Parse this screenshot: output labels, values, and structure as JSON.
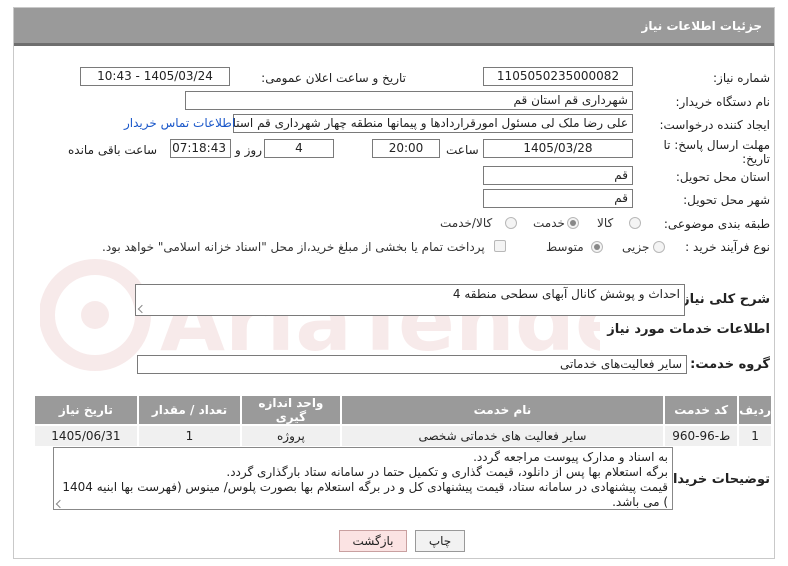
{
  "header": {
    "title": "جزئیات اطلاعات نیاز"
  },
  "form": {
    "need_number": {
      "label": "شماره نیاز:",
      "value": "1105050235000082"
    },
    "announce_datetime": {
      "label": "تاریخ و ساعت اعلان عمومی:",
      "value": "1405/03/24 - 10:43"
    },
    "buyer_org": {
      "label": "نام دستگاه خریدار:",
      "value": "شهرداری قم استان قم"
    },
    "requester": {
      "label": "ایجاد کننده درخواست:",
      "value": "علی رضا ملک لی مسئول امورقراردادها و پیمانها منطقه چهار  شهرداری قم استان قم",
      "contact_link": "اطلاعات تماس خریدار"
    },
    "deadline": {
      "label": "مهلت ارسال پاسخ: تا تاریخ:",
      "date": "1405/03/28",
      "time_label": "ساعت",
      "time": "20:00",
      "days": "4",
      "days_label": "روز و",
      "remaining": "07:18:43",
      "remaining_label": "ساعت باقی مانده"
    },
    "province": {
      "label": "استان محل تحویل:",
      "value": "قم"
    },
    "city": {
      "label": "شهر محل تحویل:",
      "value": "قم"
    },
    "category": {
      "label": "طبقه بندی موضوعی:",
      "options": [
        "کالا",
        "خدمت",
        "کالا/خدمت"
      ],
      "selected": "خدمت"
    },
    "purchase_type": {
      "label": "نوع فرآیند خرید :",
      "options": [
        "جزیی",
        "متوسط"
      ],
      "selected": "متوسط",
      "payment_note": "پرداخت تمام یا بخشی از مبلغ خرید،از محل \"اسناد خزانه اسلامی\" خواهد بود."
    }
  },
  "description": {
    "label": "شرح کلی نیاز:",
    "value": "احداث و پوشش کانال آبهای سطحی منطقه 4"
  },
  "services_section": {
    "title": "اطلاعات خدمات مورد نیاز"
  },
  "service_group": {
    "label": "گروه خدمت:",
    "value": "سایر فعالیت‌های خدماتی"
  },
  "table": {
    "headers": [
      "ردیف",
      "کد خدمت",
      "نام خدمت",
      "واحد اندازه گیری",
      "تعداد / مقدار",
      "تاریخ نیاز"
    ],
    "rows": [
      [
        "1",
        "ط-96-960",
        "سایر فعالیت های خدماتی شخصی",
        "پروژه",
        "1",
        "1405/06/31"
      ]
    ]
  },
  "buyer_notes": {
    "label": "توضیحات خریدار:",
    "lines": [
      "به اسناد و مدارک پیوست مراجعه گردد.",
      "برگه استعلام بها پس از دانلود، قیمت گذاری و تکمیل حتما در سامانه ستاد بارگذاری گردد.",
      "قیمت پیشنهادی در سامانه ستاد، قیمت پیشنهادی کل و در برگه استعلام بها بصورت پلوس/ مینوس (فهرست بها ابنیه 1404",
      ") می باشد."
    ]
  },
  "buttons": {
    "print": "چاپ",
    "back": "بازگشت"
  },
  "watermark": {
    "text": "AriaTender.net",
    "color": "#b22222"
  }
}
